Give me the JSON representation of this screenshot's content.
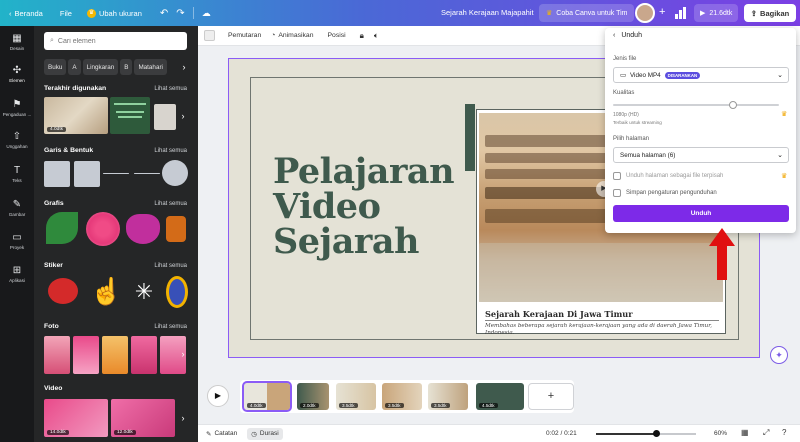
{
  "topbar": {
    "home": "Beranda",
    "file": "File",
    "resize": "Ubah ukuran",
    "title": "Sejarah Kerajaan Majapahit",
    "try_team": "Coba Canva untuk Tim",
    "duration": "21.6dtk",
    "share": "Bagikan"
  },
  "rail": {
    "items": [
      "Desain",
      "Elemen",
      "Pengaduan ...",
      "Unggahan",
      "Teks",
      "Gambar",
      "Proyek",
      "Aplikasi"
    ]
  },
  "panel": {
    "search_placeholder": "Cari elemen",
    "chips": [
      "Buku",
      "A",
      "Lingkaran",
      "B",
      "Matahari"
    ],
    "recent_title": "Terakhir digunakan",
    "recent_link": "Lihat semua",
    "recent_badge": "4.0dtk",
    "lines_title": "Garis & Bentuk",
    "lines_link": "Lihat semua",
    "graphics_title": "Grafis",
    "graphics_link": "Lihat semua",
    "stickers_title": "Stiker",
    "stickers_link": "Lihat semua",
    "photos_title": "Foto",
    "photos_link": "Lihat semua",
    "video_title": "Video",
    "video_badges": [
      "14.0dtk",
      "12.0dtk"
    ]
  },
  "toolbar": {
    "playback": "Pemutaran",
    "animate": "Animasikan",
    "position": "Posisi"
  },
  "slide": {
    "title_lines": [
      "Pelajaran",
      "Video",
      "Sejarah"
    ],
    "caption_title": "Sejarah Kerajaan Di Jawa Timur",
    "caption_text": "Membahas beberapa sejarah kerajaan-kerajaan yang ada di daerah Jawa Timur, Indonesia."
  },
  "timeline": {
    "clips": [
      "4.0dtk",
      "2.0dtk",
      "3.5dtk",
      "3.5dtk",
      "3.5dtk",
      "4.5dtk"
    ]
  },
  "bottombar": {
    "notes": "Catatan",
    "duration": "Durasi",
    "time": "0:02 / 0:21",
    "zoom": "60%",
    "zoom_level": 0.6
  },
  "download": {
    "header": "Unduh",
    "file_type_label": "Jenis file",
    "file_type_value": "Video MP4",
    "recommended": "DISARANKAN",
    "quality_label": "Kualitas",
    "quality_value": "1080p (HD)",
    "quality_note": "Terbaik untuk streaming",
    "quality_level": 0.72,
    "pages_label": "Pilih halaman",
    "pages_value": "Semua halaman (6)",
    "separate_files": "Unduh halaman sebagai file terpisah",
    "save_settings": "Simpan pengaturan pengunduhan",
    "button": "Unduh"
  },
  "colors": {
    "accent": "#7d2ae8",
    "slide_green": "#3f5a4d",
    "arrow_red": "#e01010"
  }
}
